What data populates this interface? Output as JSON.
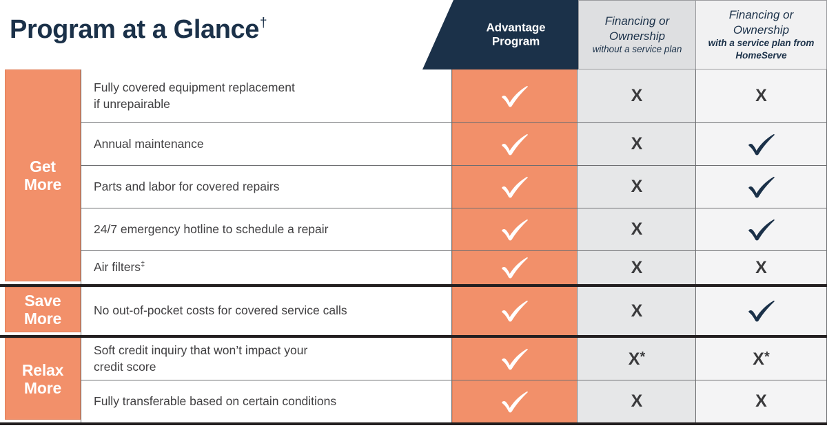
{
  "title": {
    "text": "Program at a Glance",
    "superscript": "†"
  },
  "colors": {
    "navy": "#1b3149",
    "orange": "#f2906a",
    "gray_col2": "#e6e7e8",
    "gray_col3": "#f4f4f5",
    "text": "#414042",
    "rule": "#231f20"
  },
  "columns": {
    "advantage": {
      "line1": "Advantage",
      "line2": "Program"
    },
    "financing_no_plan": {
      "main_line1": "Financing or",
      "main_line2": "Ownership",
      "sub": "without a service plan"
    },
    "financing_with_plan": {
      "main_line1": "Financing or",
      "main_line2": "Ownership",
      "sub_line1": "with a service plan from",
      "sub_line2": "HomeServe"
    }
  },
  "marks": {
    "check": "check-icon",
    "x": "X",
    "x_star": "X*"
  },
  "groups": [
    {
      "label_line1": "Get",
      "label_line2": "More",
      "rows": [
        {
          "feature_line1": "Fully covered equipment replacement",
          "feature_line2": "if unrepairable",
          "advantage": "check",
          "financing_no_plan": "x",
          "financing_with_plan": "x"
        },
        {
          "feature_line1": "Annual maintenance",
          "feature_line2": "",
          "advantage": "check",
          "financing_no_plan": "x",
          "financing_with_plan": "check"
        },
        {
          "feature_line1": "Parts and labor for covered repairs",
          "feature_line2": "",
          "advantage": "check",
          "financing_no_plan": "x",
          "financing_with_plan": "check"
        },
        {
          "feature_line1": "24/7 emergency hotline to schedule a repair",
          "feature_line2": "",
          "advantage": "check",
          "financing_no_plan": "x",
          "financing_with_plan": "check"
        },
        {
          "feature_line1": "Air filters",
          "feature_superscript": "‡",
          "feature_line2": "",
          "advantage": "check",
          "financing_no_plan": "x",
          "financing_with_plan": "x"
        }
      ]
    },
    {
      "label_line1": "Save",
      "label_line2": "More",
      "rows": [
        {
          "feature_line1": "No out-of-pocket costs for covered service calls",
          "feature_line2": "",
          "advantage": "check",
          "financing_no_plan": "x",
          "financing_with_plan": "check"
        }
      ]
    },
    {
      "label_line1": "Relax",
      "label_line2": "More",
      "rows": [
        {
          "feature_line1": "Soft credit inquiry that won’t impact your",
          "feature_line2": "credit score",
          "advantage": "check",
          "financing_no_plan": "x_star",
          "financing_with_plan": "x_star"
        },
        {
          "feature_line1": "Fully transferable based on certain conditions",
          "feature_line2": "",
          "advantage": "check",
          "financing_no_plan": "x",
          "financing_with_plan": "x"
        }
      ]
    }
  ]
}
